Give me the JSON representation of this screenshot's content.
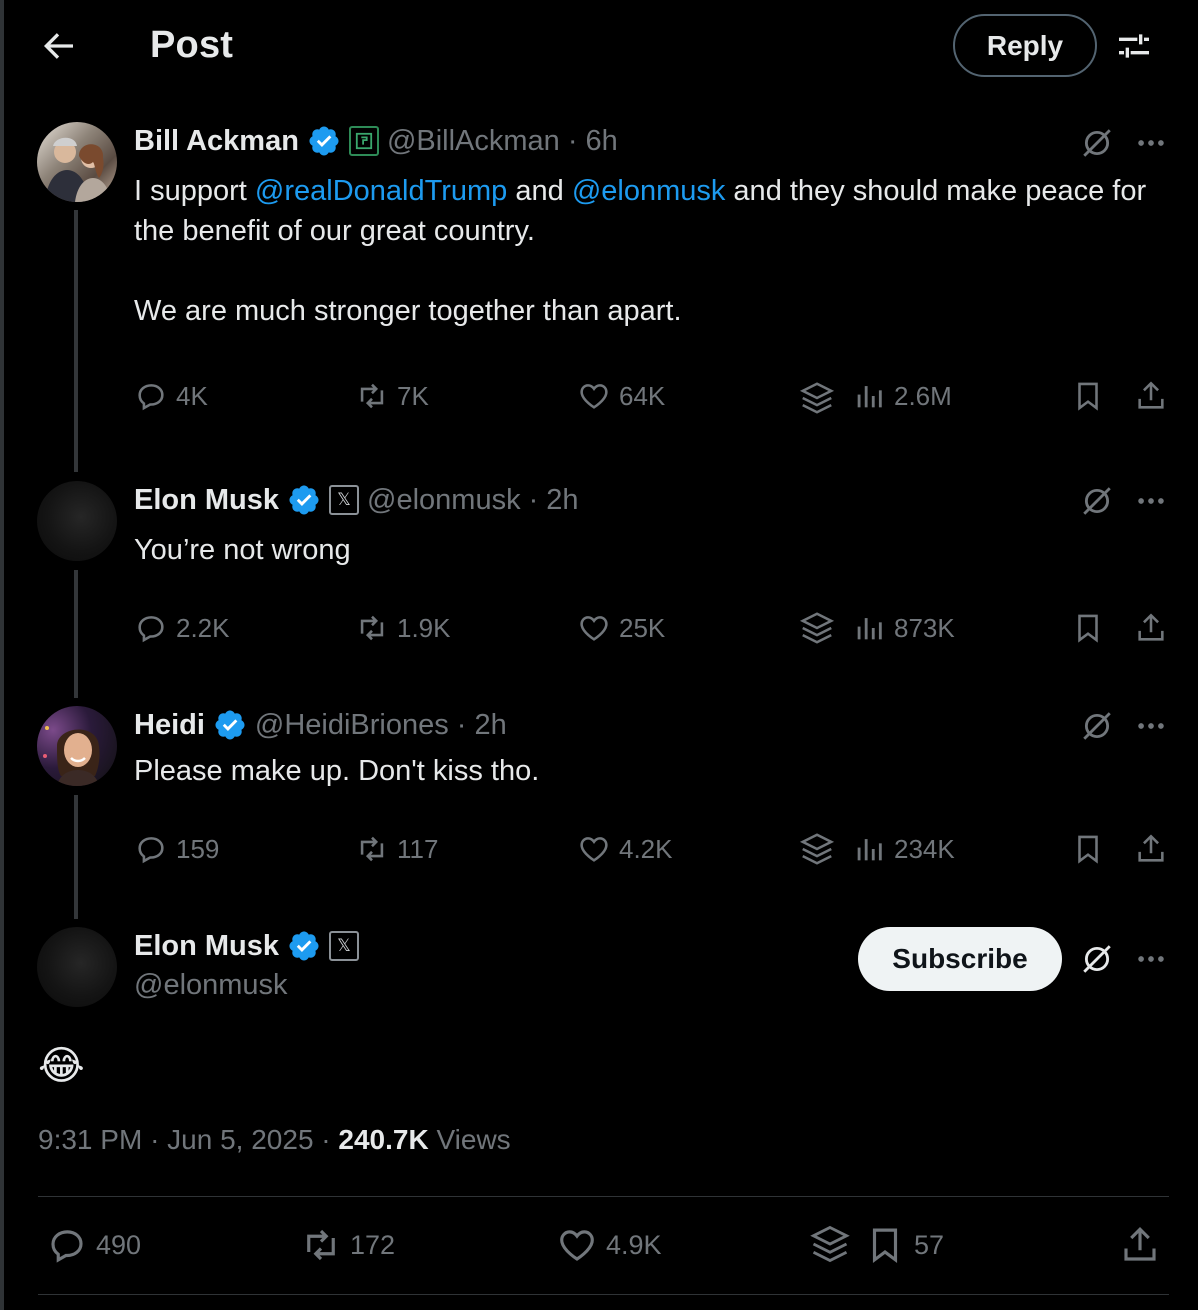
{
  "header": {
    "title": "Post",
    "reply_label": "Reply"
  },
  "tweets": [
    {
      "name": "Bill Ackman",
      "handle": "@BillAckman",
      "time": "· 6h",
      "text_parts": [
        "I support ",
        "@realDonaldTrump",
        " and ",
        "@elonmusk",
        " and they should make peace for the benefit of our great country."
      ],
      "text_line2": "We are much stronger together than apart.",
      "replies": "4K",
      "reposts": "7K",
      "likes": "64K",
      "views": "2.6M"
    },
    {
      "name": "Elon Musk",
      "handle": "@elonmusk",
      "time": "· 2h",
      "text": "You’re not wrong",
      "affiliate": "𝕏",
      "replies": "2.2K",
      "reposts": "1.9K",
      "likes": "25K",
      "views": "873K"
    },
    {
      "name": "Heidi",
      "handle": "@HeidiBriones",
      "time": "· 2h",
      "text": "Please make up. Don't kiss tho.",
      "replies": "159",
      "reposts": "117",
      "likes": "4.2K",
      "views": "234K"
    }
  ],
  "main_post": {
    "name": "Elon Musk",
    "handle": "@elonmusk",
    "affiliate": "𝕏",
    "subscribe_label": "Subscribe",
    "emoji": "😂",
    "time": "9:31 PM",
    "date": "Jun 5, 2025",
    "views_count": "240.7K",
    "views_label": "Views",
    "replies": "490",
    "reposts": "172",
    "likes": "4.9K",
    "bookmarks": "57"
  },
  "colors": {
    "background": "#000000",
    "accent": "#1d9bf0",
    "muted": "#71767b",
    "text": "#e7e9ea"
  }
}
